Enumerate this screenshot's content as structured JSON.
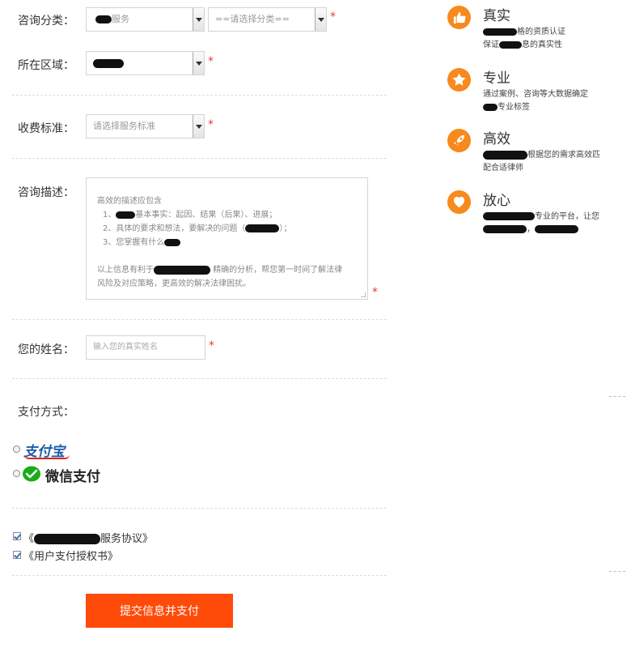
{
  "form": {
    "category": {
      "label": "咨询分类：",
      "first_value_suffix": "服务",
      "second_placeholder": "==请选择分类=="
    },
    "region": {
      "label": "所在区域："
    },
    "fee": {
      "label": "收费标准：",
      "placeholder": "请选择服务标准"
    },
    "description": {
      "label": "咨询描述：",
      "line1": "高效的描述应包含",
      "line2_suffix": "基本事实：起因、结果（后果）、进展；",
      "line3_prefix": "2、具体的要求和想法，要解决的问题（",
      "line3_suffix": "）；",
      "line4_prefix": "3、您掌握有什么",
      "line5_prefix": "以上信息有利于",
      "line5_suffix": "精确的分析，帮您第一时间了解法律",
      "line6": "风险及对应策略，更高效的解决法律困扰。"
    },
    "name": {
      "label": "您的姓名：",
      "placeholder": "输入您的真实姓名"
    },
    "payment": {
      "label": "支付方式：",
      "alipay": "支付宝",
      "wechat": "微信支付"
    },
    "agreements": {
      "service_prefix": "《",
      "service_suffix": "服务协议》",
      "auth": "《用户支付授权书》"
    },
    "required_mark": "*",
    "submit_label": "提交信息并支付"
  },
  "features": [
    {
      "title": "真实",
      "line1_suffix": "格的资质认证",
      "line2_prefix": "保证",
      "line2_suffix": "息的真实性",
      "icon": "thumbs-up-icon"
    },
    {
      "title": "专业",
      "line1": "通过案例、咨询等大数据确定",
      "line2_suffix": "专业标签",
      "icon": "star-icon"
    },
    {
      "title": "高效",
      "line1_suffix": "根据您的需求高效匹",
      "line2": "配合适律师",
      "icon": "rocket-icon"
    },
    {
      "title": "放心",
      "line1_suffix": "专业的平台，让您",
      "line2_mid": "，",
      "icon": "heart-icon"
    }
  ],
  "colors": {
    "accent": "#f7891d",
    "submit": "#ff4b0a",
    "required": "#e4393c"
  }
}
